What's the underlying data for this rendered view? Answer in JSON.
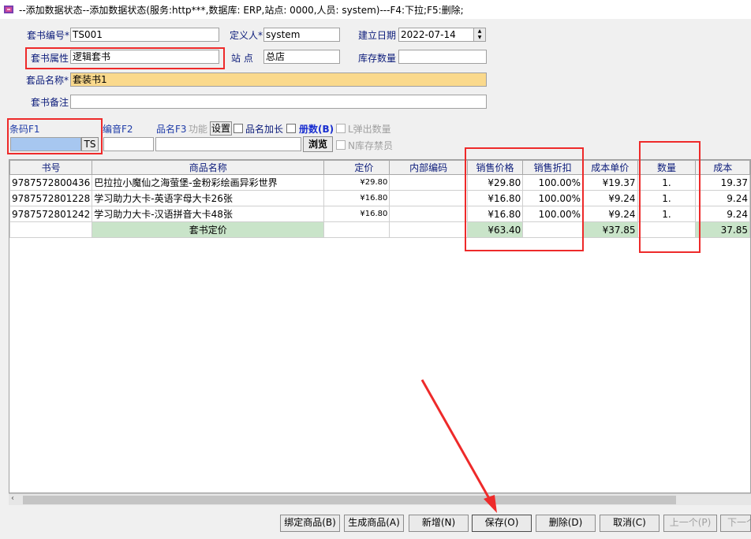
{
  "window": {
    "title": "--添加数据状态--添加数据状态(服务:http***,数据库: ERP,站点: 0000,人员: system)---F4:下拉;F5:删除;"
  },
  "form": {
    "set_code_label": "套书编号*",
    "set_code_value": "TS001",
    "definer_label": "定义人*",
    "definer_value": "system",
    "create_date_label": "建立日期",
    "create_date_value": "2022-07-14",
    "set_attr_label": "套书属性",
    "set_attr_value": "逻辑套书",
    "site_label": "站  点",
    "site_value": "总店",
    "stock_qty_label": "库存数量",
    "stock_qty_value": "",
    "product_name_label": "套品名称*",
    "product_name_value": "套装书1",
    "remark_label": "套书备注",
    "remark_value": ""
  },
  "search": {
    "barcode_label": "条码F1",
    "barcode_value": "",
    "ts_button": "TS",
    "phonetic_label": "编音F2",
    "phonetic_value": "",
    "name_label": "品名F3",
    "function_label": "功能",
    "settings_button": "设置",
    "name_extend_label": "品名加长",
    "volume_label": "册数(B)",
    "popup_qty_label": "L弹出数量",
    "browse_button": "浏览",
    "no_stock_label": "N库存禁员"
  },
  "table": {
    "columns": [
      "书号",
      "商品名称",
      "定价",
      "内部编码",
      "销售价格",
      "销售折扣",
      "成本单价",
      "数量",
      "成本"
    ],
    "rows": [
      {
        "isbn": "9787572800436",
        "name": "巴拉拉小魔仙之海萤堡-金粉彩绘画异彩世界",
        "list_price": "¥29.80",
        "internal_code": "",
        "sale_price": "¥29.80",
        "discount": "100.00%",
        "unit_cost": "¥19.37",
        "qty": "1.",
        "cost": "19.37"
      },
      {
        "isbn": "9787572801228",
        "name": "学习助力大卡-英语字母大卡26张",
        "list_price": "¥16.80",
        "internal_code": "",
        "sale_price": "¥16.80",
        "discount": "100.00%",
        "unit_cost": "¥9.24",
        "qty": "1.",
        "cost": "9.24"
      },
      {
        "isbn": "9787572801242",
        "name": "学习助力大卡-汉语拼音大卡48张",
        "list_price": "¥16.80",
        "internal_code": "",
        "sale_price": "¥16.80",
        "discount": "100.00%",
        "unit_cost": "¥9.24",
        "qty": "1.",
        "cost": "9.24"
      }
    ],
    "summary": {
      "label": "套书定价",
      "sale_total": "¥63.40",
      "unit_cost_total": "¥37.85",
      "cost_total": "37.85"
    }
  },
  "buttons": {
    "bind": "绑定商品(B)",
    "generate": "生成商品(A)",
    "add": "新增(N)",
    "save": "保存(O)",
    "delete": "删除(D)",
    "cancel": "取消(C)",
    "prev": "上一个(P)",
    "next": "下一个"
  },
  "colors": {
    "highlight_box": "#ee2a2a",
    "name_field_bg": "#fad98c",
    "summary_bg": "#c9e4c9",
    "label_blue": "#0b1b7a",
    "arrow": "#ee2a2a"
  }
}
